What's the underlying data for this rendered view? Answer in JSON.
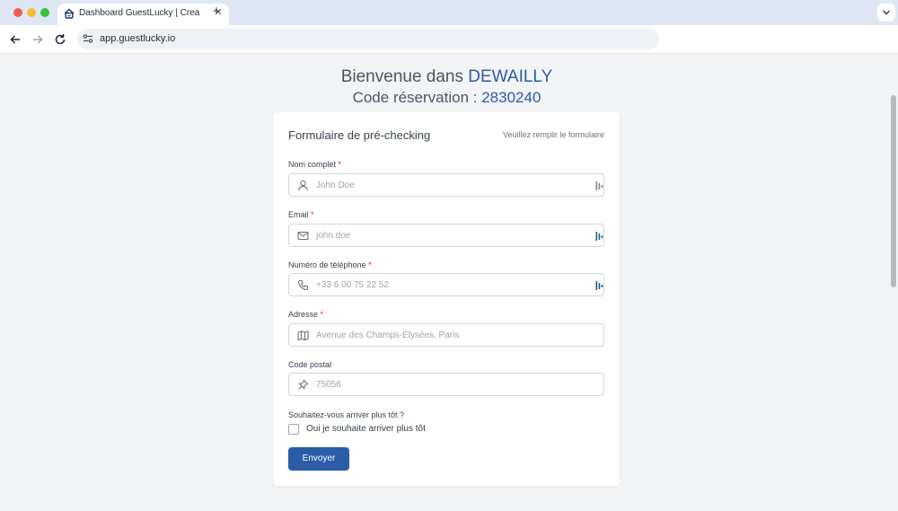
{
  "browser": {
    "tab_title": "Dashboard GuestLucky | Crea",
    "tab_close": "✕",
    "new_tab": "+",
    "url": "app.guestlucky.io"
  },
  "header": {
    "welcome_prefix": "Bienvenue dans ",
    "hotel_name": "DEWAILLY",
    "code_prefix": "Code réservation : ",
    "reservation_code": "2830240"
  },
  "form": {
    "title": "Formulaire de pré-checking",
    "hint": "Veuillez remplir le formulaire",
    "required_mark": "*",
    "fields": [
      {
        "label": "Nom complet",
        "required": true,
        "placeholder": "John Doe",
        "icon": "user-icon"
      },
      {
        "label": "Email",
        "required": true,
        "placeholder": "john.doe",
        "icon": "mail-icon"
      },
      {
        "label": "Numéro de téléphone",
        "required": true,
        "placeholder": "+33 6 00 75 22 52",
        "icon": "phone-icon"
      },
      {
        "label": "Adresse",
        "required": true,
        "placeholder": "Avenue des Champs-Élysées, Paris",
        "icon": "map-icon"
      },
      {
        "label": "Code postal",
        "required": false,
        "placeholder": "75056",
        "icon": "pin-icon"
      }
    ],
    "early_question": "Souhaitez-vous arriver plus tôt ?",
    "early_checkbox_label": "Oui je souhaite arriver plus tôt",
    "early_checked": false,
    "submit_label": "Envoyer"
  },
  "colors": {
    "accent": "#2a5ca8",
    "required": "#dc2626"
  }
}
